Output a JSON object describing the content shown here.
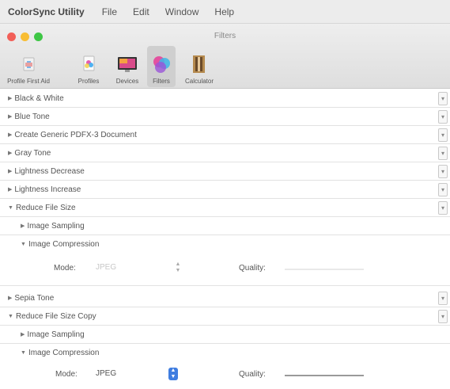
{
  "menubar": {
    "app": "ColorSync Utility",
    "items": [
      "File",
      "Edit",
      "Window",
      "Help"
    ]
  },
  "window": {
    "title": "Filters",
    "toolbar": [
      {
        "label": "Profile First Aid",
        "icon": "first-aid-icon"
      },
      {
        "label": "Profiles",
        "icon": "profiles-icon"
      },
      {
        "label": "Devices",
        "icon": "devices-icon"
      },
      {
        "label": "Filters",
        "icon": "filters-icon",
        "selected": true
      },
      {
        "label": "Calculator",
        "icon": "calculator-icon"
      }
    ]
  },
  "filters": [
    "Black & White",
    "Blue Tone",
    "Create Generic PDFX-3 Document",
    "Gray Tone",
    "Lightness Decrease",
    "Lightness Increase",
    "Reduce File Size"
  ],
  "reduce": {
    "image_sampling": "Image Sampling",
    "image_compression": "Image Compression",
    "mode_label": "Mode:",
    "mode_value": "JPEG",
    "quality_label": "Quality:"
  },
  "after": [
    "Sepia Tone",
    "Reduce File Size Copy"
  ],
  "copy": {
    "image_sampling": "Image Sampling",
    "image_compression": "Image Compression",
    "mode_label": "Mode:",
    "mode_value": "JPEG",
    "quality_label": "Quality:"
  },
  "colors": {
    "select_accent": "#3f7de0",
    "close": "#f25f58",
    "minimize": "#f8bd33",
    "zoom": "#3ec645"
  }
}
